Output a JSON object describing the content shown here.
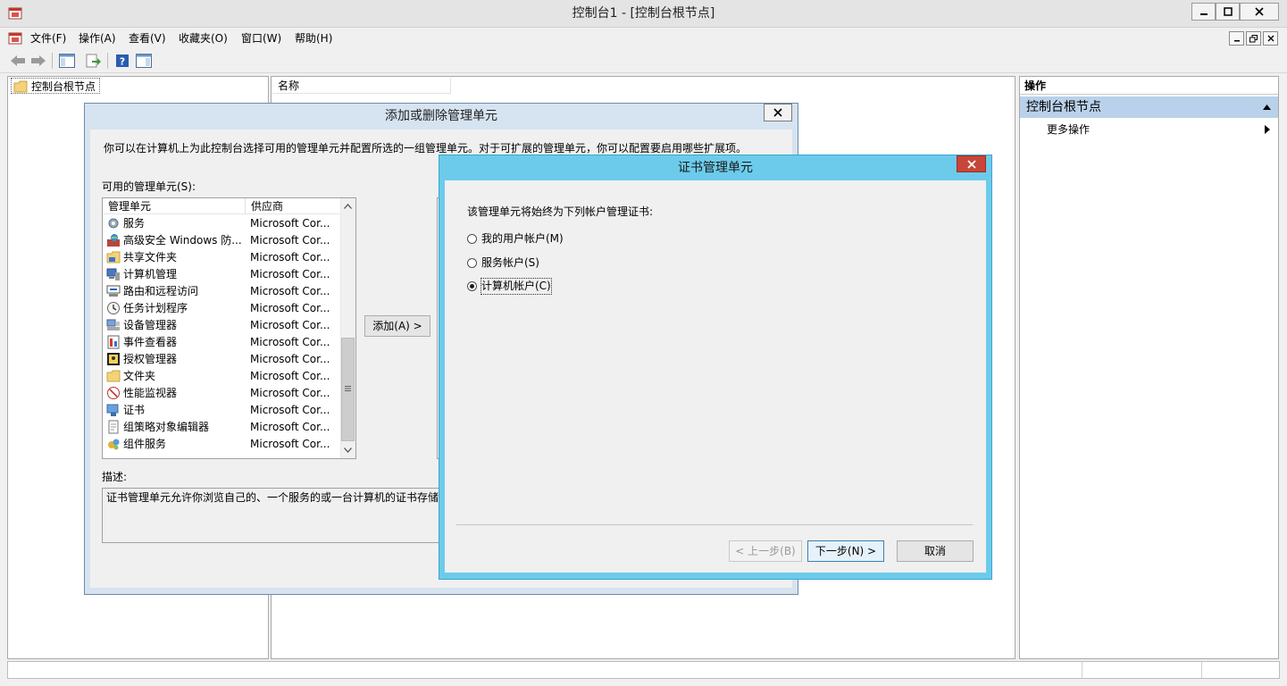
{
  "window": {
    "title": "控制台1 - [控制台根节点]"
  },
  "menu": [
    {
      "label": "文件(F)"
    },
    {
      "label": "操作(A)"
    },
    {
      "label": "查看(V)"
    },
    {
      "label": "收藏夹(O)"
    },
    {
      "label": "窗口(W)"
    },
    {
      "label": "帮助(H)"
    }
  ],
  "tree": {
    "root": "控制台根节点"
  },
  "results": {
    "col_name": "名称"
  },
  "actions": {
    "header": "操作",
    "section": "控制台根节点",
    "more": "更多操作"
  },
  "add_remove_dialog": {
    "title": "添加或删除管理单元",
    "intro": "你可以在计算机上为此控制台选择可用的管理单元并配置所选的一组管理单元。对于可扩展的管理单元，你可以配置要启用哪些扩展项。",
    "available_label": "可用的管理单元(S):",
    "columns": {
      "name": "管理单元",
      "vendor": "供应商"
    },
    "snapins": [
      {
        "name": "服务",
        "vendor": "Microsoft Cor...",
        "icon": "gear-icon"
      },
      {
        "name": "高级安全 Windows 防...",
        "vendor": "Microsoft Cor...",
        "icon": "firewall-icon"
      },
      {
        "name": "共享文件夹",
        "vendor": "Microsoft Cor...",
        "icon": "shared-folder-icon"
      },
      {
        "name": "计算机管理",
        "vendor": "Microsoft Cor...",
        "icon": "computer-management-icon"
      },
      {
        "name": "路由和远程访问",
        "vendor": "Microsoft Cor...",
        "icon": "routing-icon"
      },
      {
        "name": "任务计划程序",
        "vendor": "Microsoft Cor...",
        "icon": "clock-icon"
      },
      {
        "name": "设备管理器",
        "vendor": "Microsoft Cor...",
        "icon": "device-manager-icon"
      },
      {
        "name": "事件查看器",
        "vendor": "Microsoft Cor...",
        "icon": "event-viewer-icon"
      },
      {
        "name": "授权管理器",
        "vendor": "Microsoft Cor...",
        "icon": "authorization-icon"
      },
      {
        "name": "文件夹",
        "vendor": "Microsoft Cor...",
        "icon": "folder-icon"
      },
      {
        "name": "性能监视器",
        "vendor": "Microsoft Cor...",
        "icon": "performance-monitor-icon"
      },
      {
        "name": "证书",
        "vendor": "Microsoft Cor...",
        "icon": "certificate-icon"
      },
      {
        "name": "组策略对象编辑器",
        "vendor": "Microsoft Cor...",
        "icon": "group-policy-icon"
      },
      {
        "name": "组件服务",
        "vendor": "Microsoft Cor...",
        "icon": "component-services-icon"
      }
    ],
    "add_button": "添加(A) >",
    "description_label": "描述:",
    "description": "证书管理单元允许你浏览自己的、一个服务的或一台计算机的证书存储"
  },
  "cert_dialog": {
    "title": "证书管理单元",
    "prompt": "该管理单元将始终为下列帐户管理证书:",
    "options": [
      {
        "label": "我的用户帐户(M)",
        "selected": false
      },
      {
        "label": "服务帐户(S)",
        "selected": false
      },
      {
        "label": "计算机帐户(C)",
        "selected": true
      }
    ],
    "back_button": "< 上一步(B)",
    "next_button": "下一步(N) >",
    "cancel_button": "取消"
  }
}
